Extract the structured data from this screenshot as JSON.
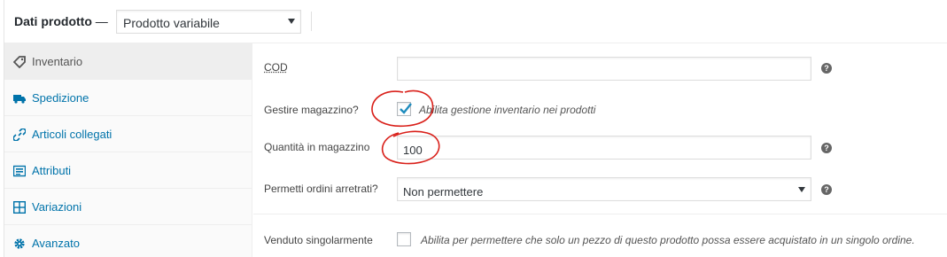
{
  "header": {
    "title": "Dati prodotto",
    "dash": "—",
    "product_type": "Prodotto variabile"
  },
  "sidebar": {
    "items": [
      {
        "label": "Inventario",
        "icon": "tag-icon",
        "active": true
      },
      {
        "label": "Spedizione",
        "icon": "truck-icon",
        "active": false
      },
      {
        "label": "Articoli collegati",
        "icon": "link-icon",
        "active": false
      },
      {
        "label": "Attributi",
        "icon": "list-icon",
        "active": false
      },
      {
        "label": "Variazioni",
        "icon": "grid-icon",
        "active": false
      },
      {
        "label": "Avanzato",
        "icon": "gear-icon",
        "active": false
      }
    ]
  },
  "inventory": {
    "sku": {
      "label": "COD",
      "value": ""
    },
    "manage_stock": {
      "label": "Gestire magazzino?",
      "checked": true,
      "description": "Abilita gestione inventario nei prodotti"
    },
    "stock_qty": {
      "label": "Quantità in magazzino",
      "value": "100"
    },
    "backorders": {
      "label": "Permetti ordini arretrati?",
      "value": "Non permettere"
    },
    "sold_individually": {
      "label": "Venduto singolarmente",
      "checked": false,
      "description": "Abilita per permettere che solo un pezzo di questo prodotto possa essere acquistato in un singolo ordine."
    },
    "help_glyph": "?"
  },
  "colors": {
    "link": "#0073aa",
    "annotation": "#d9201a",
    "check": "#1e8cbe"
  }
}
